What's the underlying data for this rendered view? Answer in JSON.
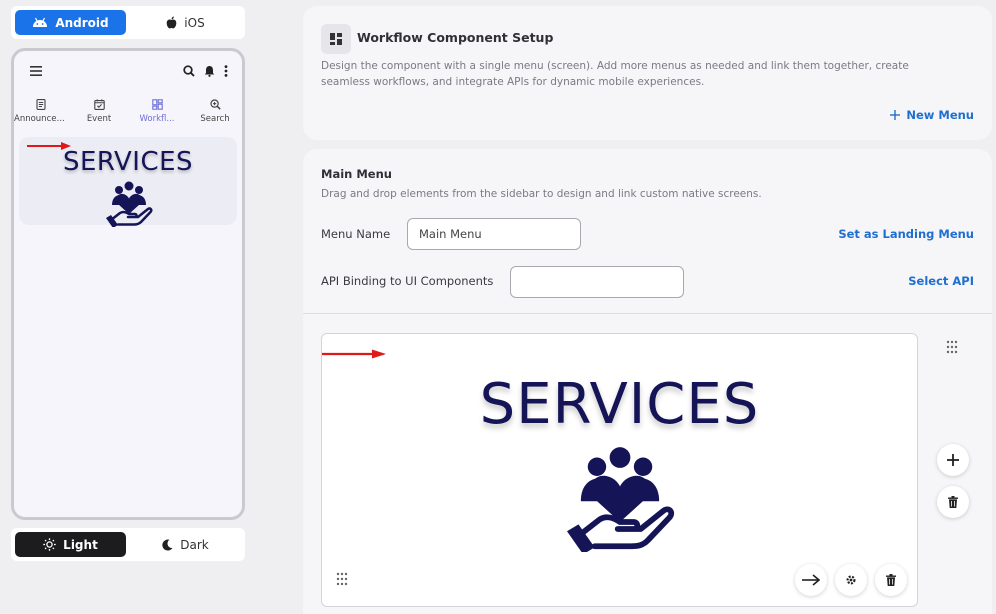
{
  "platform": {
    "android_label": "Android",
    "ios_label": "iOS",
    "selected": "Android",
    "accent": "#1a73e8"
  },
  "phone": {
    "tabs": [
      {
        "label": "Announceme...",
        "icon": "document-icon"
      },
      {
        "label": "Event",
        "icon": "calendar-check-icon"
      },
      {
        "label": "Workfl...",
        "icon": "dashboard-icon",
        "active": true
      },
      {
        "label": "Search",
        "icon": "zoom-icon"
      }
    ],
    "banner_title": "SERVICES"
  },
  "theme": {
    "light_label": "Light",
    "dark_label": "Dark",
    "selected": "Light"
  },
  "setup": {
    "title": "Workflow Component Setup",
    "description": "Design the component with a single menu (screen). Add more menus as needed and link them together, create seamless workflows, and integrate APIs for dynamic mobile experiences.",
    "new_menu_label": "New Menu"
  },
  "main_menu": {
    "title": "Main Menu",
    "description": "Drag and drop elements from the sidebar to design and link custom native screens.",
    "menu_name_label": "Menu Name",
    "menu_name_value": "Main Menu",
    "landing_label": "Set as Landing Menu",
    "api_label": "API Binding to UI Components",
    "api_value": "",
    "select_api_label": "Select API"
  },
  "canvas": {
    "banner_title": "SERVICES"
  },
  "colors": {
    "link": "#1f6fd1",
    "navy": "#141456",
    "arrow_red": "#e01818"
  }
}
